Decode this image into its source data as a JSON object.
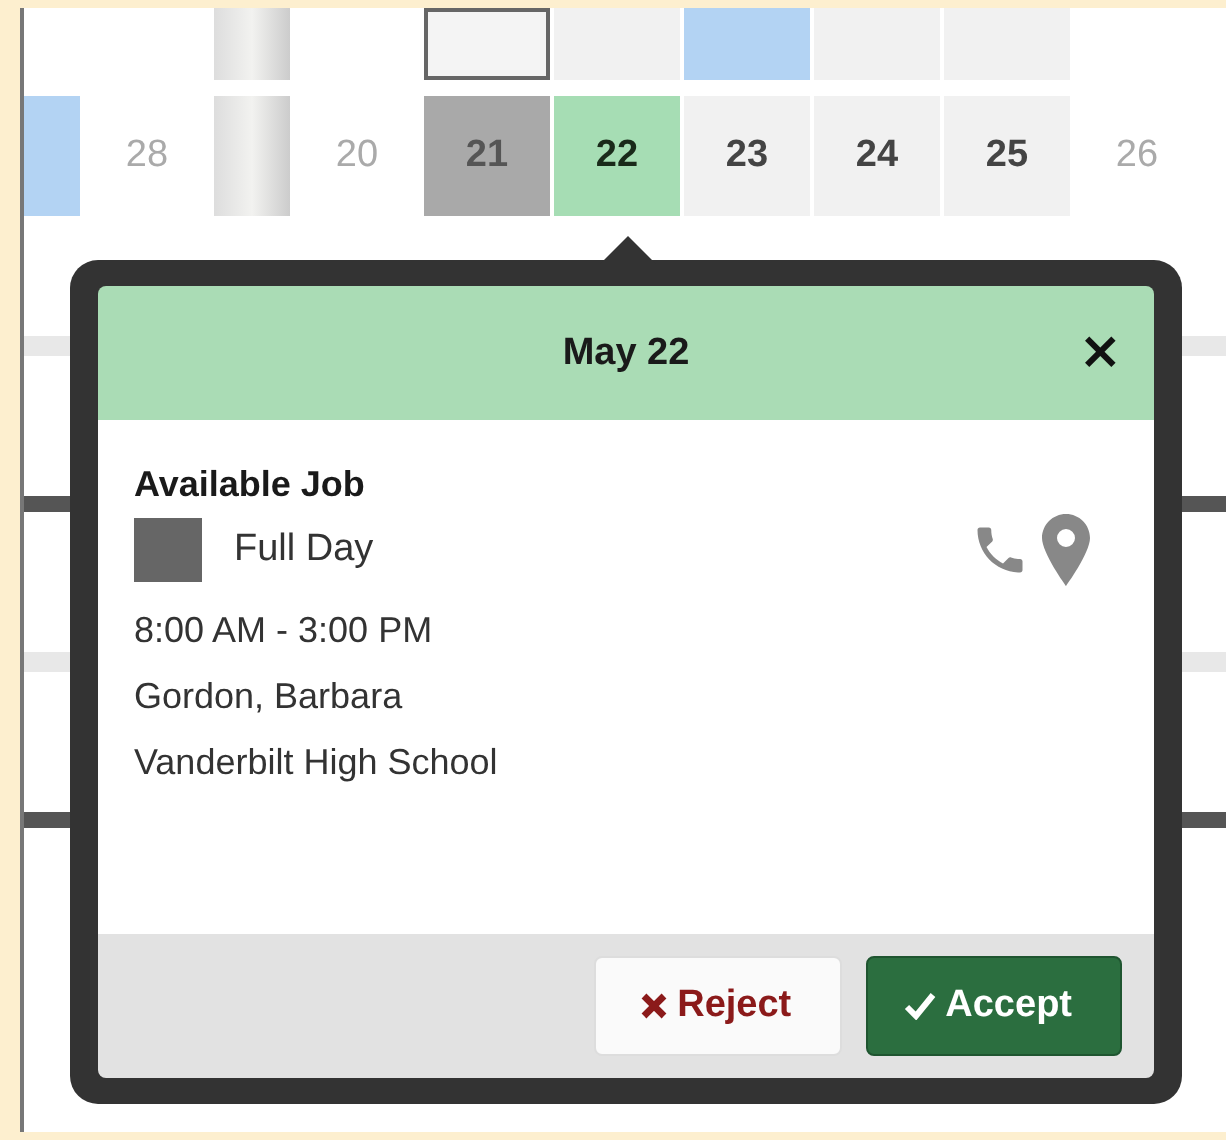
{
  "calendar": {
    "top_row": [
      {
        "kind": "blank"
      },
      {
        "kind": "blank"
      },
      {
        "kind": "gap"
      },
      {
        "kind": "blank"
      },
      {
        "kind": "outlined"
      },
      {
        "kind": "shaded"
      },
      {
        "kind": "booked"
      },
      {
        "kind": "shaded"
      },
      {
        "kind": "shaded"
      },
      {
        "kind": "blank"
      }
    ],
    "row": [
      {
        "kind": "booked"
      },
      {
        "day": "28",
        "kind": "weekend"
      },
      {
        "kind": "gap"
      },
      {
        "day": "20",
        "kind": "weekend"
      },
      {
        "day": "21",
        "kind": "unavailable"
      },
      {
        "day": "22",
        "kind": "selected"
      },
      {
        "day": "23",
        "kind": "shaded"
      },
      {
        "day": "24",
        "kind": "shaded"
      },
      {
        "day": "25",
        "kind": "shaded"
      },
      {
        "day": "26",
        "kind": "weekend"
      }
    ]
  },
  "popup": {
    "title": "May 22",
    "close": "×",
    "job_title": "Available Job",
    "type_label": "Full Day",
    "time": "8:00 AM - 3:00 PM",
    "person": "Gordon, Barbara",
    "location": "Vanderbilt High School",
    "buttons": [
      {
        "kind": "reject",
        "label": "Reject"
      },
      {
        "kind": "accept",
        "label": "Accept"
      }
    ]
  }
}
